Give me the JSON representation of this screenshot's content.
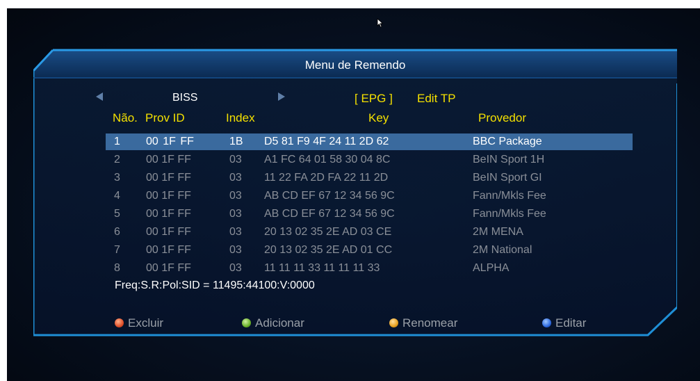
{
  "menu": {
    "title": "Menu de Remendo",
    "mode": "BISS",
    "epg": "[ EPG ]",
    "edit_tp": "Edit TP"
  },
  "columns": {
    "no": "Não.",
    "prov_id": "Prov ID",
    "index": "Index",
    "key": "Key",
    "provider": "Provedor"
  },
  "rows": [
    {
      "no": "1",
      "prov": "00  1F  FF",
      "index": "1B",
      "key": "D5 81  F9 4F  24  11  2D 62",
      "provider": "BBC Package",
      "selected": true
    },
    {
      "no": "2",
      "prov": "00  1F  FF",
      "index": "03",
      "key": "A1  FC 64  01  58  30  04  8C",
      "provider": "BeIN Sport 1H"
    },
    {
      "no": "3",
      "prov": "00  1F  FF",
      "index": "03",
      "key": "11  22  FA 2D  FA 22  11  2D",
      "provider": "BeIN Sport GI"
    },
    {
      "no": "4",
      "prov": "00  1F  FF",
      "index": "03",
      "key": "AB  CD EF  67  12  34  56  9C",
      "provider": "Fann/Mkls Fee"
    },
    {
      "no": "5",
      "prov": "00  1F  FF",
      "index": "03",
      "key": "AB  CD EF  67  12  34  56  9C",
      "provider": "Fann/Mkls Fee"
    },
    {
      "no": "6",
      "prov": "00  1F  FF",
      "index": "03",
      "key": "20  13  02  35  2E  AD 03  CE",
      "provider": "2M MENA"
    },
    {
      "no": "7",
      "prov": "00  1F  FF",
      "index": "03",
      "key": "20  13  02  35  2E  AD 01  CC",
      "provider": "2M National"
    },
    {
      "no": "8",
      "prov": "00  1F  FF",
      "index": "03",
      "key": "11  11  11  33  11  11  11  33",
      "provider": "ALPHA"
    }
  ],
  "freq": "Freq:S.R:Pol:SID = 11495:44100:V:0000",
  "buttons": [
    {
      "label": "Excluir",
      "color": "#e0502a",
      "icon": "red-button-icon"
    },
    {
      "label": "Adicionar",
      "color": "#6ab22a",
      "icon": "green-button-icon"
    },
    {
      "label": "Renomear",
      "color": "#e8a01e",
      "icon": "yellow-button-icon"
    },
    {
      "label": "Editar",
      "color": "#2e6ae0",
      "icon": "blue-button-icon"
    }
  ],
  "colors": {
    "accent": "#1f8fd6",
    "header_text": "#f4e000",
    "selected_row": "#3a6a9e"
  }
}
